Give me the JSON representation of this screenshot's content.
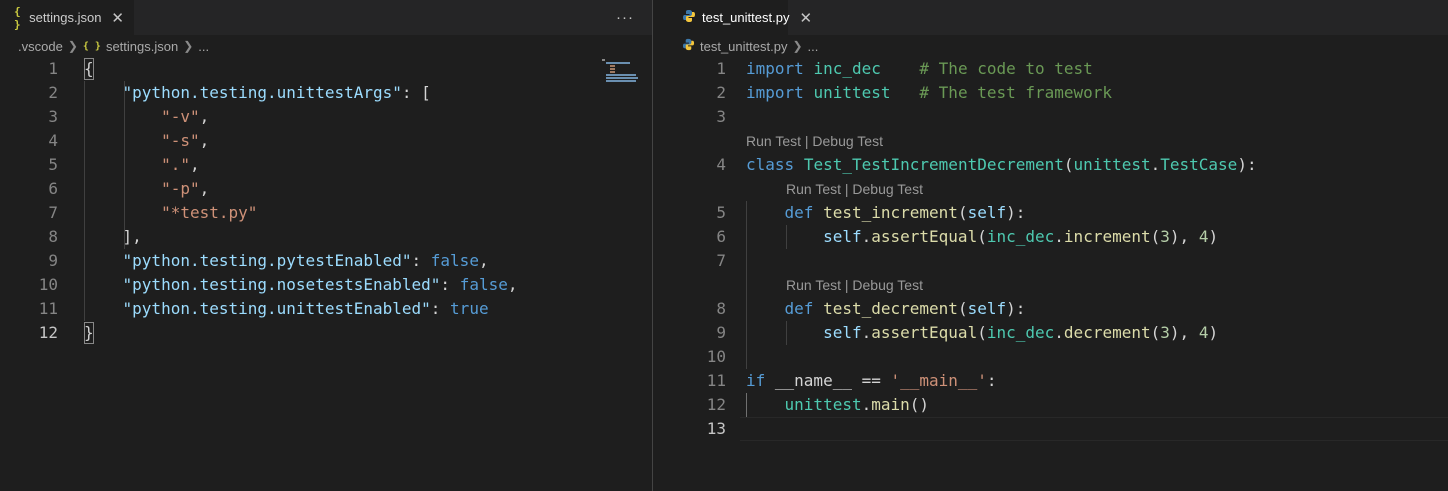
{
  "left": {
    "tab": {
      "icon": "{ }",
      "title": "settings.json",
      "close": "✕"
    },
    "more_actions": "···",
    "breadcrumb": {
      "folder": ".vscode",
      "file_icon": "{ }",
      "file": "settings.json",
      "ellipsis": "..."
    },
    "lines": [
      {
        "n": "1",
        "tokens": [
          {
            "t": "{",
            "c": "bracket"
          }
        ]
      },
      {
        "n": "2",
        "tokens": [
          {
            "t": "    ",
            "c": "bracket"
          },
          {
            "t": "\"python.testing.unittestArgs\"",
            "c": "key"
          },
          {
            "t": ": [",
            "c": "bracket"
          }
        ]
      },
      {
        "n": "3",
        "tokens": [
          {
            "t": "        ",
            "c": "bracket"
          },
          {
            "t": "\"-v\"",
            "c": "str"
          },
          {
            "t": ",",
            "c": "bracket"
          }
        ]
      },
      {
        "n": "4",
        "tokens": [
          {
            "t": "        ",
            "c": "bracket"
          },
          {
            "t": "\"-s\"",
            "c": "str"
          },
          {
            "t": ",",
            "c": "bracket"
          }
        ]
      },
      {
        "n": "5",
        "tokens": [
          {
            "t": "        ",
            "c": "bracket"
          },
          {
            "t": "\".\"",
            "c": "str"
          },
          {
            "t": ",",
            "c": "bracket"
          }
        ]
      },
      {
        "n": "6",
        "tokens": [
          {
            "t": "        ",
            "c": "bracket"
          },
          {
            "t": "\"-p\"",
            "c": "str"
          },
          {
            "t": ",",
            "c": "bracket"
          }
        ]
      },
      {
        "n": "7",
        "tokens": [
          {
            "t": "        ",
            "c": "bracket"
          },
          {
            "t": "\"*test.py\"",
            "c": "str"
          }
        ]
      },
      {
        "n": "8",
        "tokens": [
          {
            "t": "    ],",
            "c": "bracket"
          }
        ]
      },
      {
        "n": "9",
        "tokens": [
          {
            "t": "    ",
            "c": "bracket"
          },
          {
            "t": "\"python.testing.pytestEnabled\"",
            "c": "key"
          },
          {
            "t": ": ",
            "c": "bracket"
          },
          {
            "t": "false",
            "c": "kwb"
          },
          {
            "t": ",",
            "c": "bracket"
          }
        ]
      },
      {
        "n": "10",
        "tokens": [
          {
            "t": "    ",
            "c": "bracket"
          },
          {
            "t": "\"python.testing.nosetestsEnabled\"",
            "c": "key"
          },
          {
            "t": ": ",
            "c": "bracket"
          },
          {
            "t": "false",
            "c": "kwb"
          },
          {
            "t": ",",
            "c": "bracket"
          }
        ]
      },
      {
        "n": "11",
        "tokens": [
          {
            "t": "    ",
            "c": "bracket"
          },
          {
            "t": "\"python.testing.unittestEnabled\"",
            "c": "key"
          },
          {
            "t": ": ",
            "c": "bracket"
          },
          {
            "t": "true",
            "c": "kwb"
          }
        ]
      },
      {
        "n": "12",
        "tokens": [
          {
            "t": "}",
            "c": "bracket"
          }
        ]
      }
    ]
  },
  "right": {
    "tab": {
      "title": "test_unittest.py",
      "close": "✕"
    },
    "breadcrumb": {
      "file": "test_unittest.py",
      "ellipsis": "..."
    },
    "codelens_text": "Run Test | Debug Test",
    "rows": [
      {
        "type": "code",
        "n": "1",
        "tokens": [
          {
            "t": "import",
            "c": "kw"
          },
          {
            "t": " ",
            "c": "bracket"
          },
          {
            "t": "inc_dec",
            "c": "id"
          },
          {
            "t": "    ",
            "c": "bracket"
          },
          {
            "t": "# The code to test",
            "c": "cm"
          }
        ]
      },
      {
        "type": "code",
        "n": "2",
        "tokens": [
          {
            "t": "import",
            "c": "kw"
          },
          {
            "t": " ",
            "c": "bracket"
          },
          {
            "t": "unittest",
            "c": "id"
          },
          {
            "t": "   ",
            "c": "bracket"
          },
          {
            "t": "# The test framework",
            "c": "cm"
          }
        ]
      },
      {
        "type": "code",
        "n": "3",
        "tokens": []
      },
      {
        "type": "lens",
        "indent": 0
      },
      {
        "type": "code",
        "n": "4",
        "tokens": [
          {
            "t": "class",
            "c": "kw"
          },
          {
            "t": " ",
            "c": "bracket"
          },
          {
            "t": "Test_TestIncrementDecrement",
            "c": "cls"
          },
          {
            "t": "(",
            "c": "bracket"
          },
          {
            "t": "unittest",
            "c": "id"
          },
          {
            "t": ".",
            "c": "bracket"
          },
          {
            "t": "TestCase",
            "c": "cls"
          },
          {
            "t": "):",
            "c": "bracket"
          }
        ]
      },
      {
        "type": "lens",
        "indent": 1
      },
      {
        "type": "code",
        "n": "5",
        "tokens": [
          {
            "t": "    ",
            "c": "bracket"
          },
          {
            "t": "def",
            "c": "kw"
          },
          {
            "t": " ",
            "c": "bracket"
          },
          {
            "t": "test_increment",
            "c": "fn"
          },
          {
            "t": "(",
            "c": "bracket"
          },
          {
            "t": "self",
            "c": "var"
          },
          {
            "t": "):",
            "c": "bracket"
          }
        ]
      },
      {
        "type": "code",
        "n": "6",
        "tokens": [
          {
            "t": "        ",
            "c": "bracket"
          },
          {
            "t": "self",
            "c": "var"
          },
          {
            "t": ".",
            "c": "bracket"
          },
          {
            "t": "assertEqual",
            "c": "fn"
          },
          {
            "t": "(",
            "c": "bracket"
          },
          {
            "t": "inc_dec",
            "c": "id"
          },
          {
            "t": ".",
            "c": "bracket"
          },
          {
            "t": "increment",
            "c": "fn"
          },
          {
            "t": "(",
            "c": "bracket"
          },
          {
            "t": "3",
            "c": "num"
          },
          {
            "t": "), ",
            "c": "bracket"
          },
          {
            "t": "4",
            "c": "num"
          },
          {
            "t": ")",
            "c": "bracket"
          }
        ]
      },
      {
        "type": "code",
        "n": "7",
        "tokens": []
      },
      {
        "type": "lens",
        "indent": 1
      },
      {
        "type": "code",
        "n": "8",
        "tokens": [
          {
            "t": "    ",
            "c": "bracket"
          },
          {
            "t": "def",
            "c": "kw"
          },
          {
            "t": " ",
            "c": "bracket"
          },
          {
            "t": "test_decrement",
            "c": "fn"
          },
          {
            "t": "(",
            "c": "bracket"
          },
          {
            "t": "self",
            "c": "var"
          },
          {
            "t": "):",
            "c": "bracket"
          }
        ]
      },
      {
        "type": "code",
        "n": "9",
        "tokens": [
          {
            "t": "        ",
            "c": "bracket"
          },
          {
            "t": "self",
            "c": "var"
          },
          {
            "t": ".",
            "c": "bracket"
          },
          {
            "t": "assertEqual",
            "c": "fn"
          },
          {
            "t": "(",
            "c": "bracket"
          },
          {
            "t": "inc_dec",
            "c": "id"
          },
          {
            "t": ".",
            "c": "bracket"
          },
          {
            "t": "decrement",
            "c": "fn"
          },
          {
            "t": "(",
            "c": "bracket"
          },
          {
            "t": "3",
            "c": "num"
          },
          {
            "t": "), ",
            "c": "bracket"
          },
          {
            "t": "4",
            "c": "num"
          },
          {
            "t": ")",
            "c": "bracket"
          }
        ]
      },
      {
        "type": "code",
        "n": "10",
        "tokens": []
      },
      {
        "type": "code",
        "n": "11",
        "tokens": [
          {
            "t": "if",
            "c": "kw"
          },
          {
            "t": " __name__ == ",
            "c": "bracket"
          },
          {
            "t": "'__main__'",
            "c": "str"
          },
          {
            "t": ":",
            "c": "bracket"
          }
        ]
      },
      {
        "type": "code",
        "n": "12",
        "tokens": [
          {
            "t": "    ",
            "c": "bracket"
          },
          {
            "t": "unittest",
            "c": "id"
          },
          {
            "t": ".",
            "c": "bracket"
          },
          {
            "t": "main",
            "c": "fn"
          },
          {
            "t": "()",
            "c": "bracket"
          }
        ]
      },
      {
        "type": "code",
        "n": "13",
        "tokens": []
      }
    ]
  },
  "colors": {
    "editor_bg": "#1e1e1e",
    "tabbar_bg": "#252526",
    "line_number": "#858585",
    "keyword": "#569cd6",
    "string": "#ce9178",
    "json_key": "#9cdcfe",
    "type": "#4ec9b0",
    "function": "#dcdcaa",
    "number": "#b5cea8",
    "comment": "#6a9955"
  }
}
